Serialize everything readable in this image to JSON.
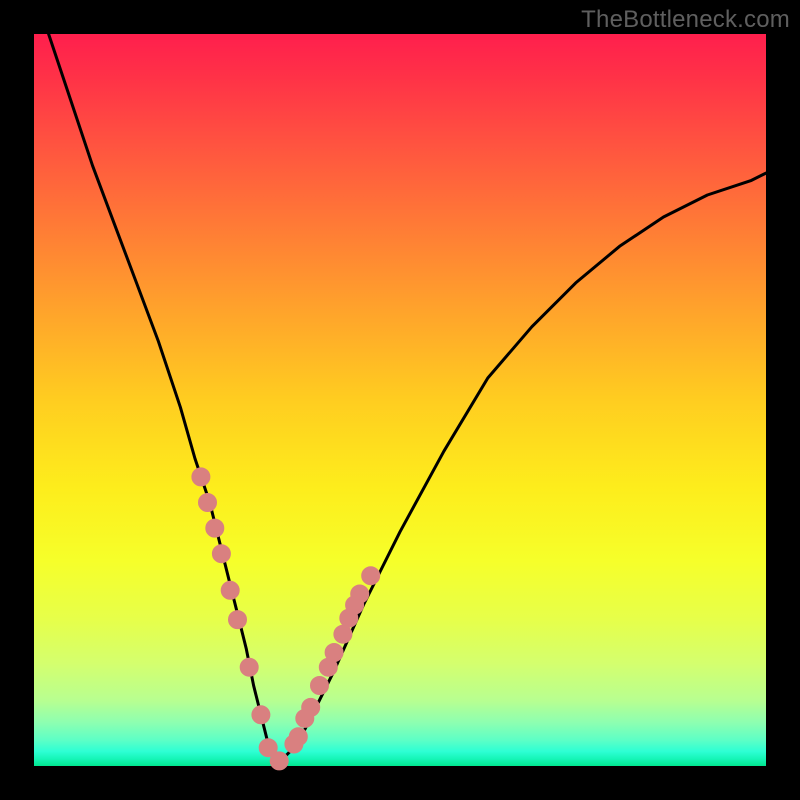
{
  "watermark": "TheBottleneck.com",
  "chart_data": {
    "type": "line",
    "title": "",
    "xlabel": "",
    "ylabel": "",
    "xlim": [
      0,
      100
    ],
    "ylim": [
      0,
      100
    ],
    "grid": false,
    "series": [
      {
        "name": "curve",
        "color": "#000000",
        "x": [
          2,
          5,
          8,
          11,
          14,
          17,
          20,
          22,
          24,
          26,
          27,
          28,
          29,
          30,
          31,
          32,
          33,
          34,
          36,
          38,
          41,
          45,
          50,
          56,
          62,
          68,
          74,
          80,
          86,
          92,
          98,
          100
        ],
        "y": [
          100,
          91,
          82,
          74,
          66,
          58,
          49,
          42,
          36,
          28,
          24,
          20,
          16,
          11,
          7,
          3,
          1,
          1,
          3,
          7,
          13,
          22,
          32,
          43,
          53,
          60,
          66,
          71,
          75,
          78,
          80,
          81
        ]
      },
      {
        "name": "markers",
        "color": "#d98080",
        "type": "scatter",
        "x_left": [
          22.8,
          23.7,
          24.7,
          25.6,
          26.8,
          27.8,
          29.4,
          31.0,
          32.0,
          33.5
        ],
        "y_left": [
          39.5,
          36.0,
          32.5,
          29.0,
          24.0,
          20.0,
          13.5,
          7.0,
          2.5,
          0.7
        ],
        "x_right": [
          35.5,
          36.1,
          37.0,
          37.8,
          39.0,
          40.2,
          41.0,
          42.2,
          43.0,
          43.8,
          44.5,
          46.0
        ],
        "y_right": [
          3.0,
          4.0,
          6.5,
          8.0,
          11.0,
          13.5,
          15.5,
          18.0,
          20.2,
          22.0,
          23.5,
          26.0
        ]
      }
    ],
    "gradient_colors": {
      "top": "#ff1f4d",
      "middle": "#fded1c",
      "bottom": "#00e690"
    }
  }
}
